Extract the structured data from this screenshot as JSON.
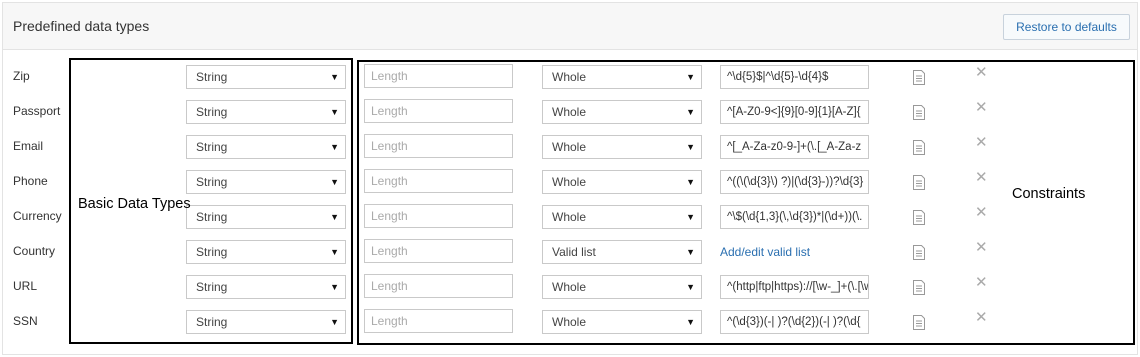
{
  "panel": {
    "title": "Predefined data types",
    "restore_label": "Restore to defaults"
  },
  "annotations": {
    "basic_label": "Basic Data Types",
    "constraints_label": "Constraints"
  },
  "rows": [
    {
      "name": "Zip",
      "type": "String",
      "length_placeholder": "Length",
      "rule": "Whole",
      "pattern": "^\\d{5}$|^\\d{5}-\\d{4}$"
    },
    {
      "name": "Passport",
      "type": "String",
      "length_placeholder": "Length",
      "rule": "Whole",
      "pattern": "^[A-Z0-9<]{9}[0-9]{1}[A-Z]{"
    },
    {
      "name": "Email",
      "type": "String",
      "length_placeholder": "Length",
      "rule": "Whole",
      "pattern": "^[_A-Za-z0-9-]+(\\.[_A-Za-z"
    },
    {
      "name": "Phone",
      "type": "String",
      "length_placeholder": "Length",
      "rule": "Whole",
      "pattern": "^((\\(\\d{3}\\) ?)|(\\d{3}-))?\\d{3}"
    },
    {
      "name": "Currency",
      "type": "String",
      "length_placeholder": "Length",
      "rule": "Whole",
      "pattern": "^\\$(\\d{1,3}(\\,\\d{3})*|(\\d+))(\\."
    },
    {
      "name": "Country",
      "type": "String",
      "length_placeholder": "Length",
      "rule": "Valid list",
      "link": "Add/edit valid list"
    },
    {
      "name": "URL",
      "type": "String",
      "length_placeholder": "Length",
      "rule": "Whole",
      "pattern": "^(http|ftp|https)://[\\w-_]+(\\.[\\w"
    },
    {
      "name": "SSN",
      "type": "String",
      "length_placeholder": "Length",
      "rule": "Whole",
      "pattern": "^(\\d{3})(-| )?(\\d{2})(-| )?(\\d{"
    }
  ],
  "icons": {
    "select_arrow": "▼",
    "edit": "document-icon",
    "delete": "close-icon"
  }
}
